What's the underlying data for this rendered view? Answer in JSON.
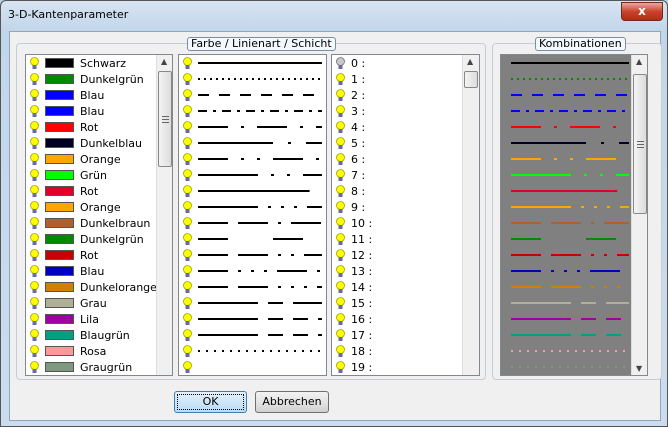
{
  "window": {
    "title": "3-D-Kantenparameter",
    "close_label": "x"
  },
  "group_main": {
    "label": "Farbe / Linienart / Schicht"
  },
  "group_combo": {
    "label": "Kombinationen"
  },
  "colors": [
    {
      "name": "Schwarz",
      "hex": "#000000"
    },
    {
      "name": "Dunkelgrün",
      "hex": "#008a00"
    },
    {
      "name": "Blau",
      "hex": "#0000ff"
    },
    {
      "name": "Blau",
      "hex": "#0000ff"
    },
    {
      "name": "Rot",
      "hex": "#ff0000"
    },
    {
      "name": "Dunkelblau",
      "hex": "#000022"
    },
    {
      "name": "Orange",
      "hex": "#ffa500"
    },
    {
      "name": "Grün",
      "hex": "#00ff00"
    },
    {
      "name": "Rot",
      "hex": "#e0002a"
    },
    {
      "name": "Orange",
      "hex": "#ffa500"
    },
    {
      "name": "Dunkelbraun",
      "hex": "#b0602a"
    },
    {
      "name": "Dunkelgrün",
      "hex": "#008a00"
    },
    {
      "name": "Rot",
      "hex": "#c80000"
    },
    {
      "name": "Blau",
      "hex": "#0000c0"
    },
    {
      "name": "Dunkelorange",
      "hex": "#d08000"
    },
    {
      "name": "Grau",
      "hex": "#b0b098"
    },
    {
      "name": "Lila",
      "hex": "#a000a0"
    },
    {
      "name": "Blaugrün",
      "hex": "#00a080"
    },
    {
      "name": "Rosa",
      "hex": "#ff9898"
    },
    {
      "name": "Graugrün",
      "hex": "#7f9880"
    }
  ],
  "linetypes": [
    "solid",
    "2 4",
    "11 10",
    "9 6 3 6",
    "30 13 3 13",
    "75 15 3 15",
    "30 13 3 13 3 13",
    "60 13 3 13 3 13",
    "solid-short",
    "60 10 3 10 3 10 3 10",
    "30 10 30 10 3 10",
    "30 45",
    "30 10 30 10 3 10 3 10",
    "30 10 3 10 3 10 3 10",
    "30 10 30 10 3 10 3 10 3 10",
    "60 10 15 10",
    "60 10 15 10 15 10",
    "60 10 15 10 15 10",
    "2 6",
    ""
  ],
  "layers": [
    {
      "label": "0 :",
      "on": false
    },
    {
      "label": "1 :",
      "on": true
    },
    {
      "label": "2 :",
      "on": true
    },
    {
      "label": "3 :",
      "on": true
    },
    {
      "label": "4 :",
      "on": true
    },
    {
      "label": "5 :",
      "on": true
    },
    {
      "label": "6 :",
      "on": true
    },
    {
      "label": "7 :",
      "on": true
    },
    {
      "label": "8 :",
      "on": true
    },
    {
      "label": "9 :",
      "on": true
    },
    {
      "label": "10 :",
      "on": true
    },
    {
      "label": "11 :",
      "on": true
    },
    {
      "label": "12 :",
      "on": true
    },
    {
      "label": "13 :",
      "on": true
    },
    {
      "label": "14 :",
      "on": true
    },
    {
      "label": "15 :",
      "on": true
    },
    {
      "label": "16 :",
      "on": true
    },
    {
      "label": "17 :",
      "on": true
    },
    {
      "label": "18 :",
      "on": true
    },
    {
      "label": "19 :",
      "on": true
    }
  ],
  "buttons": {
    "ok": "OK",
    "cancel": "Abbrechen"
  }
}
